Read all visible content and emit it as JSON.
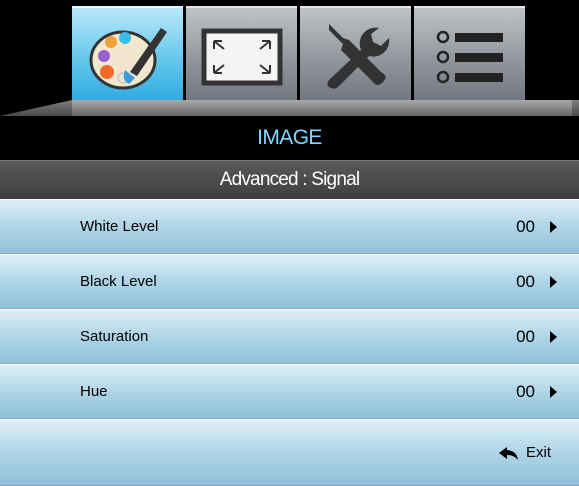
{
  "tabs": [
    {
      "id": "image",
      "icon": "palette-icon",
      "active": true
    },
    {
      "id": "display",
      "icon": "resize-screen-icon",
      "active": false
    },
    {
      "id": "setup",
      "icon": "tools-icon",
      "active": false
    },
    {
      "id": "options",
      "icon": "list-icon",
      "active": false
    }
  ],
  "header": {
    "title": "IMAGE",
    "subtitle": "Advanced : Signal"
  },
  "rows": [
    {
      "label": "White Level",
      "value": "00"
    },
    {
      "label": "Black Level",
      "value": "00"
    },
    {
      "label": "Saturation",
      "value": "00"
    },
    {
      "label": "Hue",
      "value": "00"
    }
  ],
  "footer": {
    "exit_label": "Exit"
  },
  "colors": {
    "title_text": "#7fd8ff",
    "active_tab": "#5bc2ea",
    "row_bg": "#b4d7e8"
  }
}
